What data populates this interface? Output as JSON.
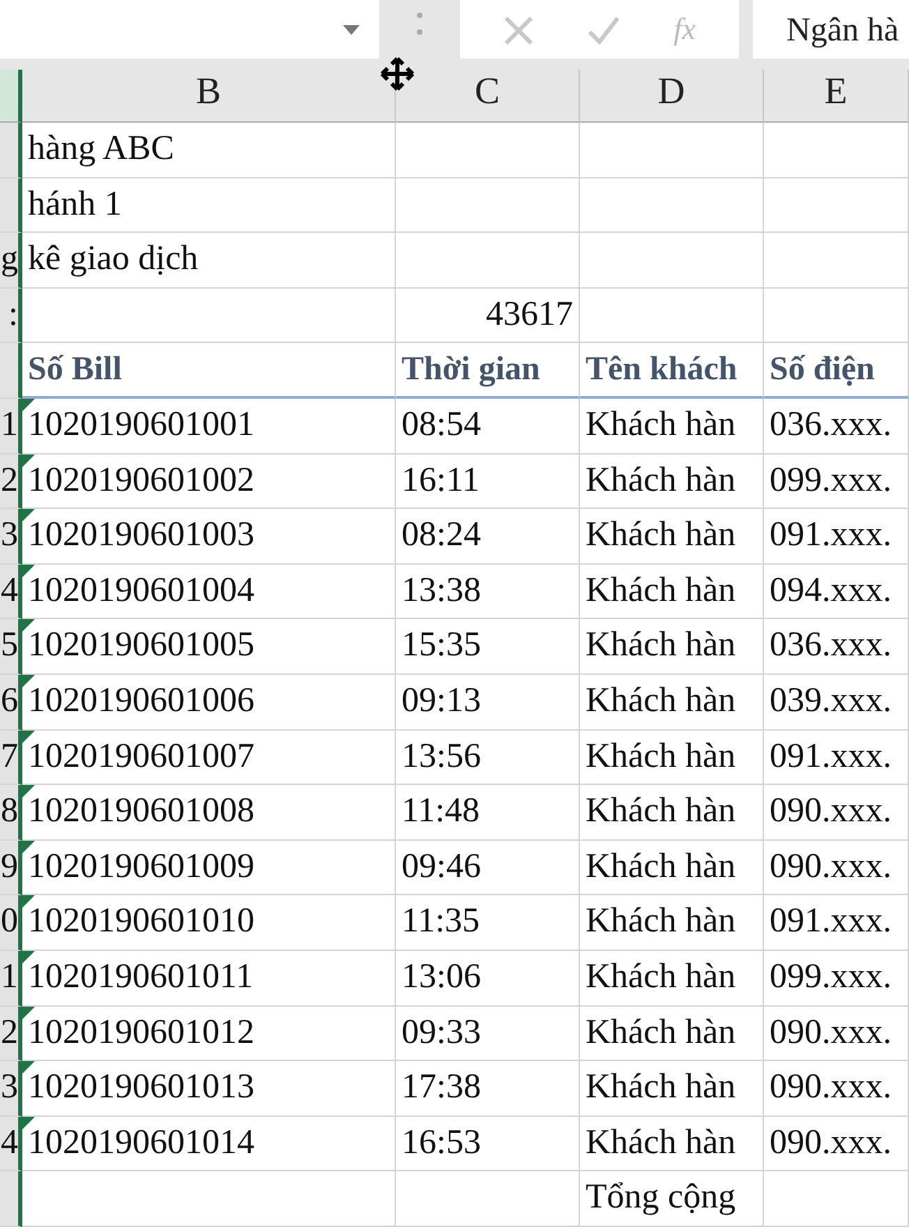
{
  "formula_bar": {
    "buttons": [
      {
        "kind": "cancel",
        "disabled": true
      },
      {
        "kind": "enter",
        "disabled": true
      },
      {
        "kind": "function",
        "label": "fx",
        "disabled": true
      }
    ],
    "content": "Ngân hà"
  },
  "columns": [
    {
      "selected": true
    },
    {
      "label": "B",
      "selected": false
    },
    {
      "label": "C",
      "selected": false
    },
    {
      "label": "D",
      "selected": false
    },
    {
      "label": "E",
      "selected": false
    }
  ],
  "rows": [
    {
      "kind": "title",
      "b": "hàng ABC"
    },
    {
      "kind": "title",
      "b": "hánh 1"
    },
    {
      "kind": "title",
      "a": "g",
      "b": "kê giao dịch"
    },
    {
      "kind": "date",
      "a": ":",
      "c": "43617"
    },
    {
      "kind": "header",
      "b": "Số Bill",
      "c": "Thời gian",
      "d": "Tên khách",
      "e": "Số điện"
    },
    {
      "kind": "data",
      "flag": true,
      "a": "1",
      "b": "1020190601001",
      "c": "08:54",
      "d": "Khách hàn",
      "e": "036.xxx."
    },
    {
      "kind": "data",
      "flag": true,
      "a": "2",
      "b": "1020190601002",
      "c": "16:11",
      "d": "Khách hàn",
      "e": "099.xxx."
    },
    {
      "kind": "data",
      "flag": true,
      "a": "3",
      "b": "1020190601003",
      "c": "08:24",
      "d": "Khách hàn",
      "e": "091.xxx."
    },
    {
      "kind": "data",
      "flag": true,
      "a": "4",
      "b": "1020190601004",
      "c": "13:38",
      "d": "Khách hàn",
      "e": "094.xxx."
    },
    {
      "kind": "data",
      "flag": true,
      "a": "5",
      "b": "1020190601005",
      "c": "15:35",
      "d": "Khách hàn",
      "e": "036.xxx."
    },
    {
      "kind": "data",
      "flag": true,
      "a": "6",
      "b": "1020190601006",
      "c": "09:13",
      "d": "Khách hàn",
      "e": "039.xxx."
    },
    {
      "kind": "data",
      "flag": true,
      "a": "7",
      "b": "1020190601007",
      "c": "13:56",
      "d": "Khách hàn",
      "e": "091.xxx."
    },
    {
      "kind": "data",
      "flag": true,
      "a": "8",
      "b": "1020190601008",
      "c": "11:48",
      "d": "Khách hàn",
      "e": "090.xxx."
    },
    {
      "kind": "data",
      "flag": true,
      "a": "9",
      "b": "1020190601009",
      "c": "09:46",
      "d": "Khách hàn",
      "e": "090.xxx."
    },
    {
      "kind": "data",
      "flag": true,
      "a": "0",
      "b": "1020190601010",
      "c": "11:35",
      "d": "Khách hàn",
      "e": "091.xxx."
    },
    {
      "kind": "data",
      "flag": true,
      "a": "1",
      "b": "1020190601011",
      "c": "13:06",
      "d": "Khách hàn",
      "e": "099.xxx."
    },
    {
      "kind": "data",
      "flag": true,
      "a": "2",
      "b": "1020190601012",
      "c": "09:33",
      "d": "Khách hàn",
      "e": "090.xxx."
    },
    {
      "kind": "data",
      "flag": true,
      "a": "3",
      "b": "1020190601013",
      "c": "17:38",
      "d": "Khách hàn",
      "e": "090.xxx."
    },
    {
      "kind": "data",
      "flag": true,
      "a": "4",
      "b": "1020190601014",
      "c": "16:53",
      "d": "Khách hàn",
      "e": "090.xxx."
    },
    {
      "kind": "data",
      "d": "Tổng cộng"
    }
  ]
}
